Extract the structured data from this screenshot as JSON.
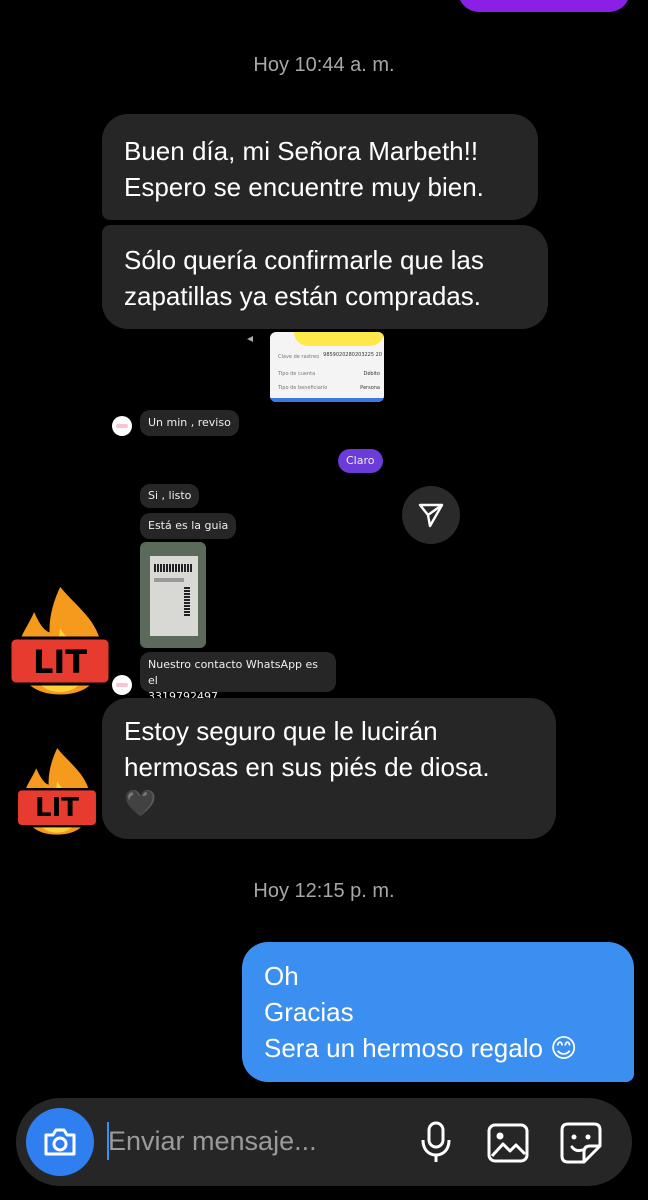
{
  "timestamps": [
    "Hoy 10:44 a. m.",
    "Hoy 12:15 p. m."
  ],
  "messages_in": [
    {
      "lines": [
        "Buen día, mi Señora Marbeth!!",
        "Espero se encuentre muy bien."
      ]
    },
    {
      "lines": [
        "Sólo quería confirmarle que las",
        "zapatillas ya están compradas."
      ]
    },
    {
      "lines": [
        "Estoy seguro que le lucirán",
        "hermosas en sus piés de diosa."
      ],
      "emoji": "🖤"
    }
  ],
  "embedded_screenshot": {
    "card_rows": [
      {
        "label": "Clave de rastreo",
        "value": "9859020280203225 20"
      },
      {
        "label": "Tipo de cuenta",
        "value": "Débito"
      },
      {
        "label": "Tipo de beneficiario",
        "value": "Persona"
      }
    ],
    "msg_un_min": "Un min , reviso",
    "msg_claro": "Claro",
    "msg_si_listo": "Si , listo",
    "msg_guia": "Está es la guia",
    "msg_contacto": [
      "Nuestro contacto WhatsApp es el",
      "3319792497"
    ]
  },
  "reactions": [
    "LIT",
    "LIT"
  ],
  "message_out": {
    "lines": [
      "Oh",
      "Gracias",
      "Sera un hermoso regalo 😊"
    ]
  },
  "composer": {
    "placeholder": "Enviar mensaje..."
  },
  "colors": {
    "outgoing": "#3a8ff0",
    "incoming": "#262626",
    "purple": "#8a1fe6",
    "camera": "#2f7ff0"
  }
}
